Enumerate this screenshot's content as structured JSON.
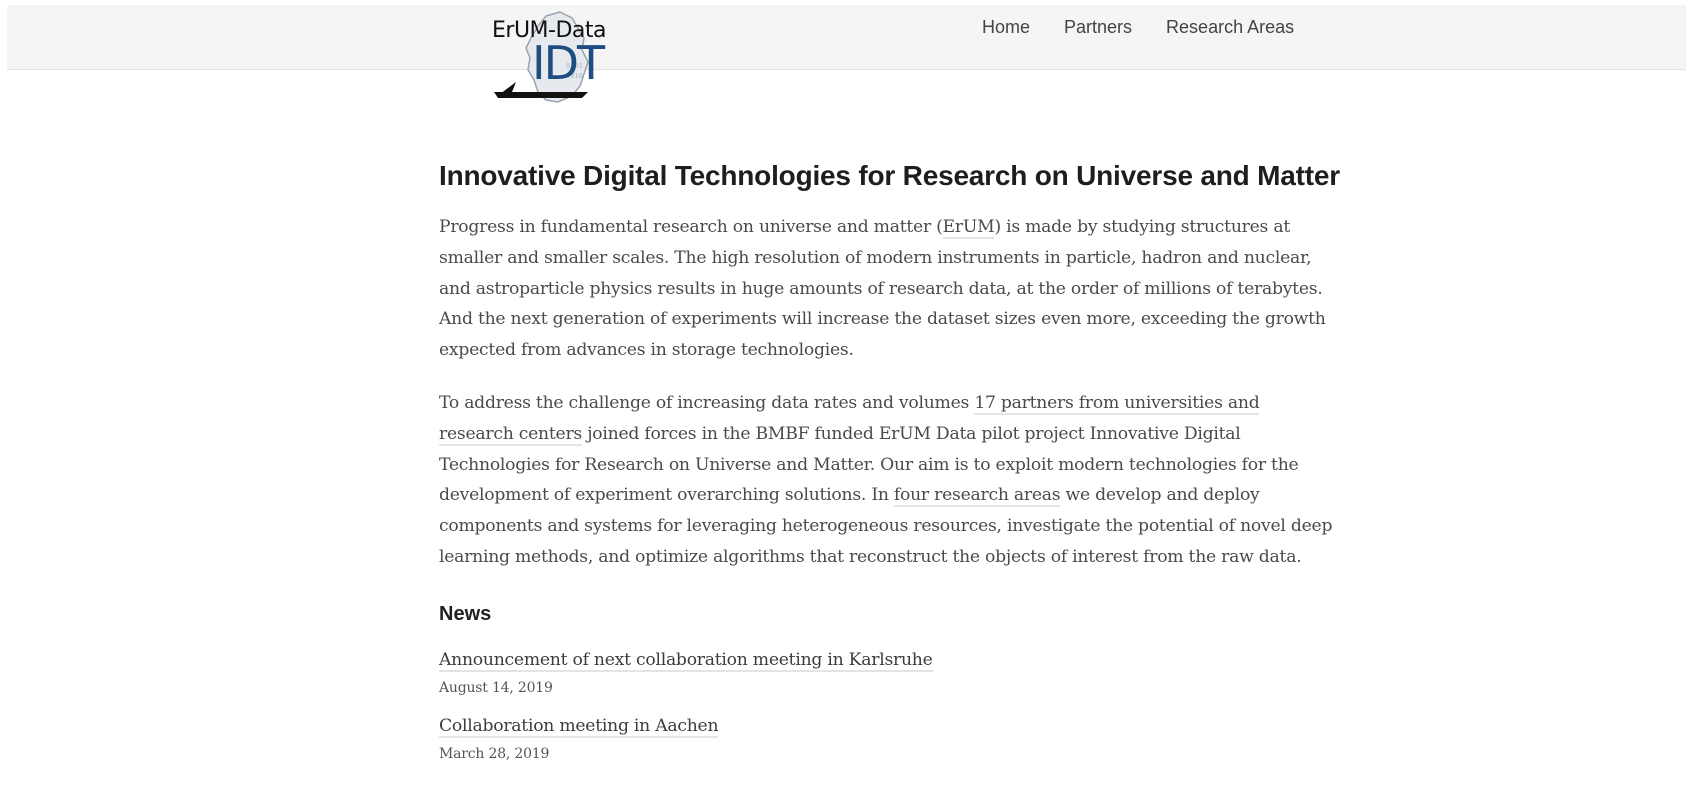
{
  "header": {
    "logo_line1": "ErUM-Data",
    "logo_line2": "IDT",
    "nav": [
      {
        "label": "Home"
      },
      {
        "label": "Partners"
      },
      {
        "label": "Research Areas"
      }
    ]
  },
  "main": {
    "title": "Innovative Digital Technologies for Research on Universe and Matter",
    "p1": {
      "pre": "Progress in fundamental research on universe and matter (",
      "link": "ErUM",
      "post": ") is made by studying structures at smaller and smaller scales. The high resolution of modern instruments in particle, hadron and nuclear, and astroparticle physics results in huge amounts of research data, at the order of millions of terabytes. And the next generation of experiments will increase the dataset sizes even more, exceeding the growth expected from advances in storage technologies."
    },
    "p2": {
      "pre": "To address the challenge of increasing data rates and volumes ",
      "link1": "17 partners from universities and research centers",
      "mid": " joined forces in the BMBF funded ErUM Data pilot project Innovative Digital Technologies for Research on Universe and Matter. Our aim is to exploit modern technologies for the development of experiment overarching solutions. In ",
      "link2": "four research areas",
      "post": " we develop and deploy components and systems for leveraging heterogeneous resources, investigate the potential of novel deep learning methods, and optimize algorithms that reconstruct the objects of interest from the raw data."
    },
    "news_heading": "News",
    "news": [
      {
        "title": "Announcement of next collaboration meeting in Karlsruhe",
        "date": "August 14, 2019"
      },
      {
        "title": "Collaboration meeting in Aachen",
        "date": "March 28, 2019"
      }
    ]
  }
}
